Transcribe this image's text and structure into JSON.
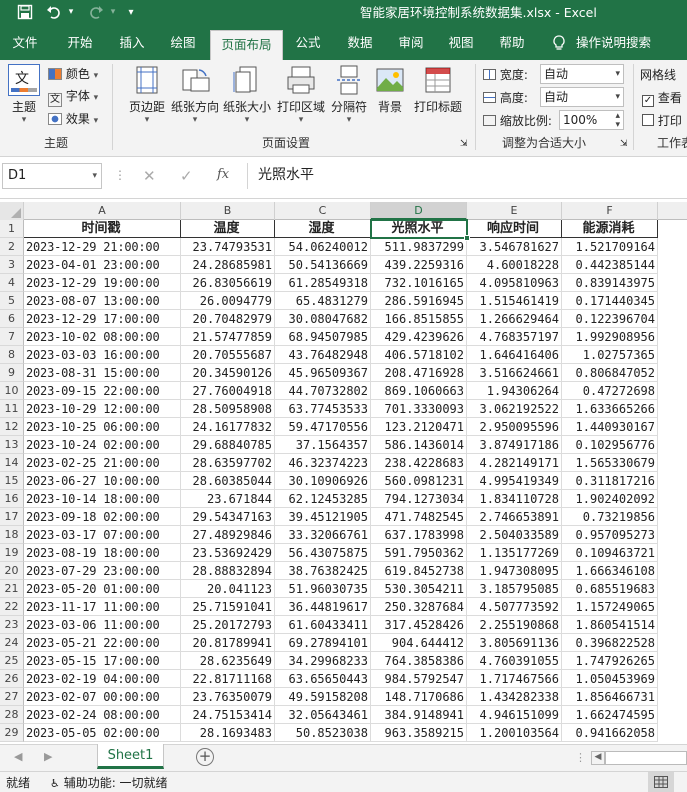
{
  "window": {
    "title": "智能家居环境控制系统数据集.xlsx  -  Excel",
    "qat": {
      "customize": "▾"
    }
  },
  "ribbon_tabs": [
    "文件",
    "开始",
    "插入",
    "绘图",
    "页面布局",
    "公式",
    "数据",
    "审阅",
    "视图",
    "帮助",
    "操作说明搜索"
  ],
  "active_tab": "页面布局",
  "ribbon": {
    "theme_group": {
      "label": "主题",
      "theme_btn": "主题",
      "colors": "颜色",
      "fonts": "字体",
      "effects": "效果",
      "theme_icon_text": "文"
    },
    "page_setup": {
      "label": "页面设置",
      "margins": "页边距",
      "orientation": "纸张方向",
      "size": "纸张大小",
      "print_area": "打印区域",
      "breaks": "分隔符",
      "background": "背景",
      "print_titles": "打印标题"
    },
    "scale": {
      "label": "调整为合适大小",
      "width_label": "宽度:",
      "width_value": "自动",
      "height_label": "高度:",
      "height_value": "自动",
      "scale_label": "缩放比例:",
      "scale_value": "100%"
    },
    "sheet_options": {
      "label": "工作表",
      "gridlines": "网格线",
      "view": "查看",
      "print": "打印"
    }
  },
  "formula_bar": {
    "name_box": "D1",
    "formula": "光照水平",
    "fx": "fx"
  },
  "columns": [
    "A",
    "B",
    "C",
    "D",
    "E",
    "F"
  ],
  "selected_column": "D",
  "headers": [
    "时间戳",
    "温度",
    "湿度",
    "光照水平",
    "响应时间",
    "能源消耗"
  ],
  "rows": [
    [
      "2023-12-29 21:00:00",
      "23.74793531",
      "54.06240012",
      "511.9837299",
      "3.546781627",
      "1.521709164"
    ],
    [
      "2023-04-01 23:00:00",
      "24.28685981",
      "50.54136669",
      "439.2259316",
      "4.60018228",
      "0.442385144"
    ],
    [
      "2023-12-29 19:00:00",
      "26.83056619",
      "61.28549318",
      "732.1016165",
      "4.095810963",
      "0.839143975"
    ],
    [
      "2023-08-07 13:00:00",
      "26.0094779",
      "65.4831279",
      "286.5916945",
      "1.515461419",
      "0.171440345"
    ],
    [
      "2023-12-29 17:00:00",
      "20.70482979",
      "30.08047682",
      "166.8515855",
      "1.266629464",
      "0.122396704"
    ],
    [
      "2023-10-02 08:00:00",
      "21.57477859",
      "68.94507985",
      "429.4239626",
      "4.768357197",
      "1.992908956"
    ],
    [
      "2023-03-03 16:00:00",
      "20.70555687",
      "43.76482948",
      "406.5718102",
      "1.646416406",
      "1.02757365"
    ],
    [
      "2023-08-31 15:00:00",
      "20.34590126",
      "45.96509367",
      "208.4716928",
      "3.516624661",
      "0.806847052"
    ],
    [
      "2023-09-15 22:00:00",
      "27.76004918",
      "44.70732802",
      "869.1060663",
      "1.94306264",
      "0.47272698"
    ],
    [
      "2023-10-29 12:00:00",
      "28.50958908",
      "63.77453533",
      "701.3330093",
      "3.062192522",
      "1.633665266"
    ],
    [
      "2023-10-25 06:00:00",
      "24.16177832",
      "59.47170556",
      "123.2120471",
      "2.950095596",
      "1.440930167"
    ],
    [
      "2023-10-24 02:00:00",
      "29.68840785",
      "37.1564357",
      "586.1436014",
      "3.874917186",
      "0.102956776"
    ],
    [
      "2023-02-25 21:00:00",
      "28.63597702",
      "46.32374223",
      "238.4228683",
      "4.282149171",
      "1.565330679"
    ],
    [
      "2023-06-27 10:00:00",
      "28.60385044",
      "30.10906926",
      "560.0981231",
      "4.995419349",
      "0.311817216"
    ],
    [
      "2023-10-14 18:00:00",
      "23.671844",
      "62.12453285",
      "794.1273034",
      "1.834110728",
      "1.902402092"
    ],
    [
      "2023-09-18 02:00:00",
      "29.54347163",
      "39.45121905",
      "471.7482545",
      "2.746653891",
      "0.73219856"
    ],
    [
      "2023-03-17 07:00:00",
      "27.48929846",
      "33.32066761",
      "637.1783998",
      "2.504033589",
      "0.957095273"
    ],
    [
      "2023-08-19 18:00:00",
      "23.53692429",
      "56.43075875",
      "591.7950362",
      "1.135177269",
      "0.109463721"
    ],
    [
      "2023-07-29 23:00:00",
      "28.88832894",
      "38.76382425",
      "619.8452738",
      "1.947308095",
      "1.666346108"
    ],
    [
      "2023-05-20 01:00:00",
      "20.041123",
      "51.96030735",
      "530.3054211",
      "3.185795085",
      "0.685519683"
    ],
    [
      "2023-11-17 11:00:00",
      "25.71591041",
      "36.44819617",
      "250.3287684",
      "4.507773592",
      "1.157249065"
    ],
    [
      "2023-03-06 11:00:00",
      "25.20172793",
      "61.60433411",
      "317.4528426",
      "2.255190868",
      "1.860541514"
    ],
    [
      "2023-05-21 22:00:00",
      "20.81789941",
      "69.27894101",
      "904.644412",
      "3.805691136",
      "0.396822528"
    ],
    [
      "2023-05-15 17:00:00",
      "28.6235649",
      "34.29968233",
      "764.3858386",
      "4.760391055",
      "1.747926265"
    ],
    [
      "2023-02-19 04:00:00",
      "22.81711168",
      "63.65650443",
      "984.5792547",
      "1.717467566",
      "1.050453969"
    ],
    [
      "2023-02-07 00:00:00",
      "23.76350079",
      "49.59158208",
      "148.7170686",
      "1.434282338",
      "1.856466731"
    ],
    [
      "2023-02-24 08:00:00",
      "24.75153414",
      "32.05643461",
      "384.9148941",
      "4.946151099",
      "1.662474595"
    ],
    [
      "2023-05-05 02:00:00",
      "28.1693483",
      "50.8523038",
      "963.3589215",
      "1.200103564",
      "0.941662058"
    ]
  ],
  "sheet_tabs": [
    "Sheet1"
  ],
  "status": {
    "ready": "就绪",
    "accessibility": "辅助功能: 一切就绪"
  }
}
